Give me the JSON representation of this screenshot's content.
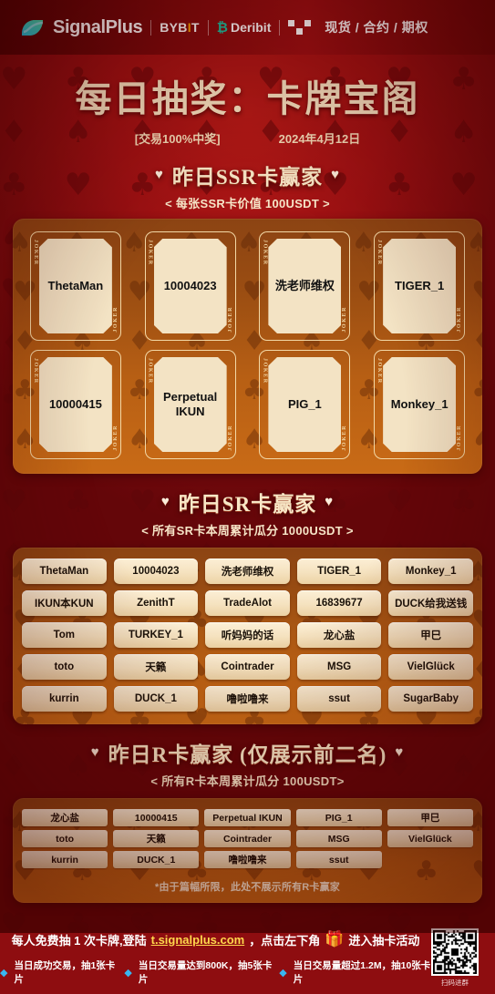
{
  "topbar": {
    "brand": "SignalPlus",
    "partners": [
      "BYBIT",
      "Deribit",
      "OKX"
    ],
    "pairs_label": "现货 / 合约 / 期权"
  },
  "headline": {
    "title": "每日抽奖：卡牌宝阁",
    "tag": "[交易100%中奖]",
    "date": "2024年4月12日"
  },
  "ssr": {
    "heading": "昨日SSR卡赢家",
    "heart": "♥",
    "subtitle": "< 每张SSR卡价值 100USDT >",
    "card_label_top": "JOKER",
    "card_label_bottom": "JOKER",
    "winners": [
      "ThetaMan",
      "10004023",
      "洗老师维权",
      "TIGER_1",
      "10000415",
      "Perpetual IKUN",
      "PIG_1",
      "Monkey_1"
    ]
  },
  "sr": {
    "heading": "昨日SR卡赢家",
    "heart": "♥",
    "subtitle": "< 所有SR卡本周累计瓜分 1000USDT >",
    "winners": [
      "ThetaMan",
      "10004023",
      "洗老师维权",
      "TIGER_1",
      "Monkey_1",
      "IKUN本KUN",
      "ZenithT",
      "TradeAlot",
      "16839677",
      "DUCK给我送钱",
      "Tom",
      "TURKEY_1",
      "听妈妈的话",
      "龙心盐",
      "甲巳",
      "toto",
      "天籁",
      "Cointrader",
      "MSG",
      "VielGlück",
      "kurrin",
      "DUCK_1",
      "噜啦噜来",
      "ssut",
      "SugarBaby"
    ]
  },
  "r": {
    "heading": "昨日R卡赢家 (仅展示前二名)",
    "heart": "♥",
    "subtitle": "< 所有R卡本周累计瓜分 100USDT>",
    "winners": [
      "龙心盐",
      "10000415",
      "Perpetual IKUN",
      "PIG_1",
      "甲巳",
      "toto",
      "天籁",
      "Cointrader",
      "MSG",
      "VielGlück",
      "kurrin",
      "DUCK_1",
      "噜啦噜来",
      "ssut"
    ],
    "note": "*由于篇幅所限，此处不展示所有R卡赢家"
  },
  "footer": {
    "line1_a": "每人免费抽 1 次卡牌,登陆",
    "link": "t.signalplus.com",
    "line1_b": "，点击左下角",
    "gift_icon": "🎁",
    "line1_c": "进入抽卡活动",
    "rules": [
      "当日成功交易，抽1张卡片",
      "当日交易量达到800K，抽5张卡片",
      "当日交易量超过1.2M，抽10张卡片"
    ],
    "bullet": "◆",
    "qr_label": "扫码进群"
  },
  "colors": {
    "bg_red": "#8e0d10",
    "panel_orange": "#b75f14",
    "cream": "#f3e3c4",
    "gold_text": "#f6e2c0",
    "link_yellow": "#ffd84d",
    "accent_blue": "#39b6f0"
  }
}
